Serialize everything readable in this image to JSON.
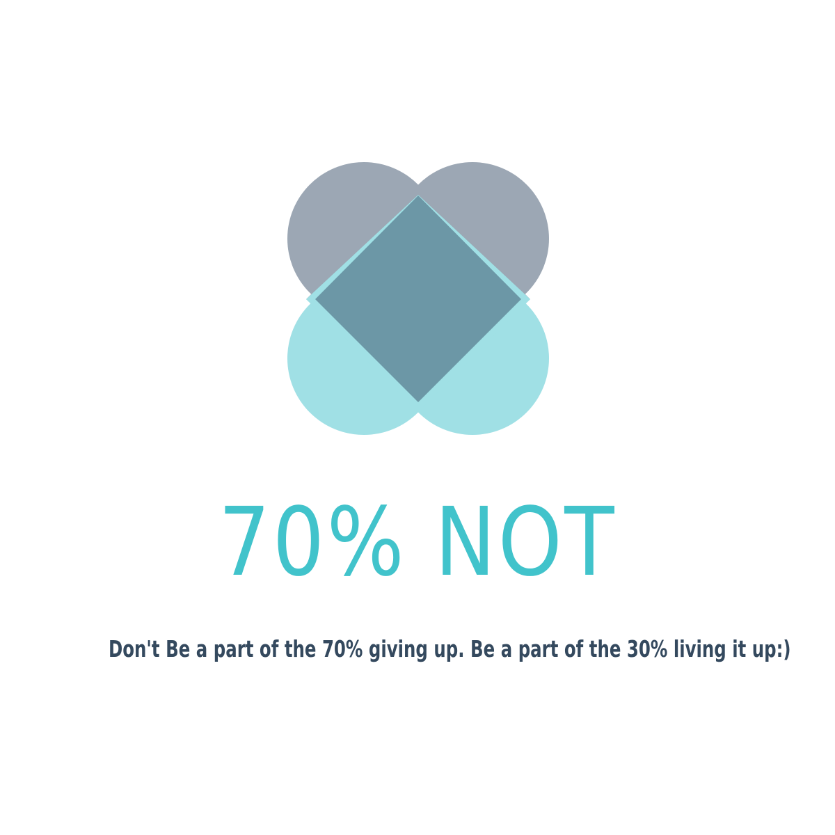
{
  "colors": {
    "top_heart": "#9ca7b4",
    "bottom_heart": "#a0e0e5",
    "overlap": "#6c97a6",
    "accent": "#41c3cb",
    "text": "#34495e"
  },
  "headline": "70% NOT",
  "tagline": "Don't Be a part of the 70% giving up. Be a part of the 30% living it up:)"
}
